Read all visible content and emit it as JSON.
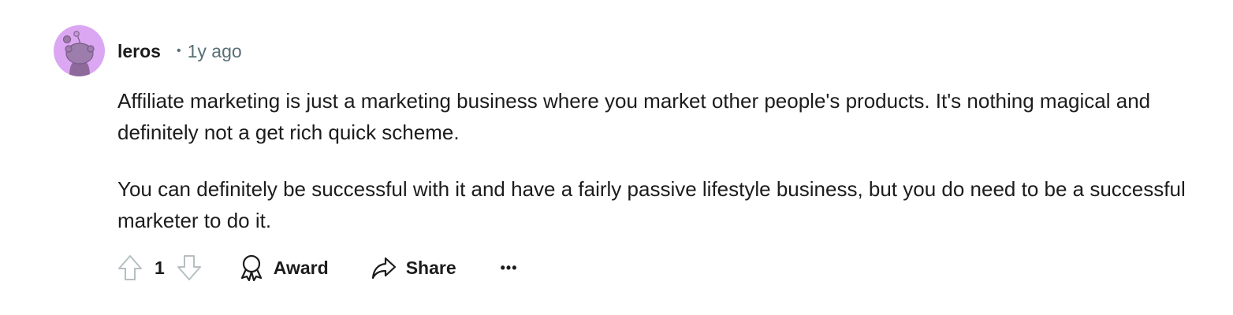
{
  "comment": {
    "author": "leros",
    "separator": "•",
    "time": "1y ago",
    "avatar_icon": "snoo-avatar-icon",
    "avatar_color": "#dba7f2",
    "paragraphs": [
      "Affiliate marketing is just a marketing business where you market other people's products. It's nothing magical and definitely not a get rich quick scheme.",
      "You can definitely be successful with it and have a fairly passive lifestyle business, but you do need to be a successful marketer to do it."
    ]
  },
  "actions": {
    "upvote_icon": "upvote-arrow-icon",
    "downvote_icon": "downvote-arrow-icon",
    "score": "1",
    "award_label": "Award",
    "award_icon": "award-ribbon-icon",
    "share_label": "Share",
    "share_icon": "share-arrow-icon",
    "more_label": "•••",
    "more_icon": "ellipsis-icon"
  },
  "colors": {
    "text": "#1c1c1c",
    "muted": "#576f76",
    "icon_muted": "#b6bfc2"
  }
}
